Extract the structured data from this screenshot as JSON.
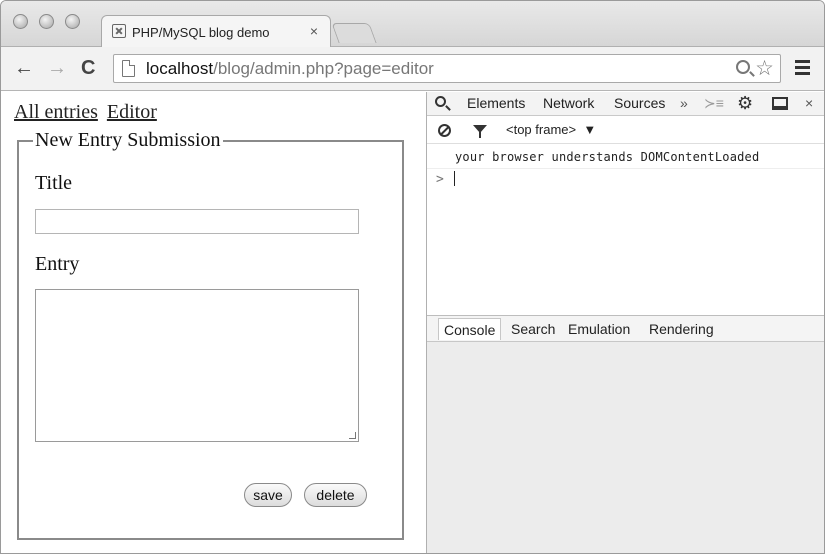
{
  "browser": {
    "tab_title": "PHP/MySQL blog demo",
    "tab_close": "×",
    "url_host": "localhost",
    "url_path": "/blog/admin.php?page=editor",
    "back": "←",
    "forward": "→",
    "reload": "C",
    "star": "☆"
  },
  "page": {
    "nav": [
      "All entries",
      "Editor"
    ],
    "legend": "New Entry Submission",
    "title_label": "Title",
    "title_value": "",
    "entry_label": "Entry",
    "entry_value": "",
    "save_label": "save",
    "delete_label": "delete"
  },
  "devtools": {
    "tabs": [
      "Elements",
      "Network",
      "Sources"
    ],
    "more": "»",
    "drawer_toggle": "≻≡",
    "gear": "⚙",
    "close": "×",
    "frame": "<top frame>",
    "frame_arrow": "▼",
    "log_message": "your browser understands DOMContentLoaded",
    "prompt": ">",
    "drawer_tabs": [
      "Console",
      "Search",
      "Emulation",
      "Rendering"
    ]
  }
}
